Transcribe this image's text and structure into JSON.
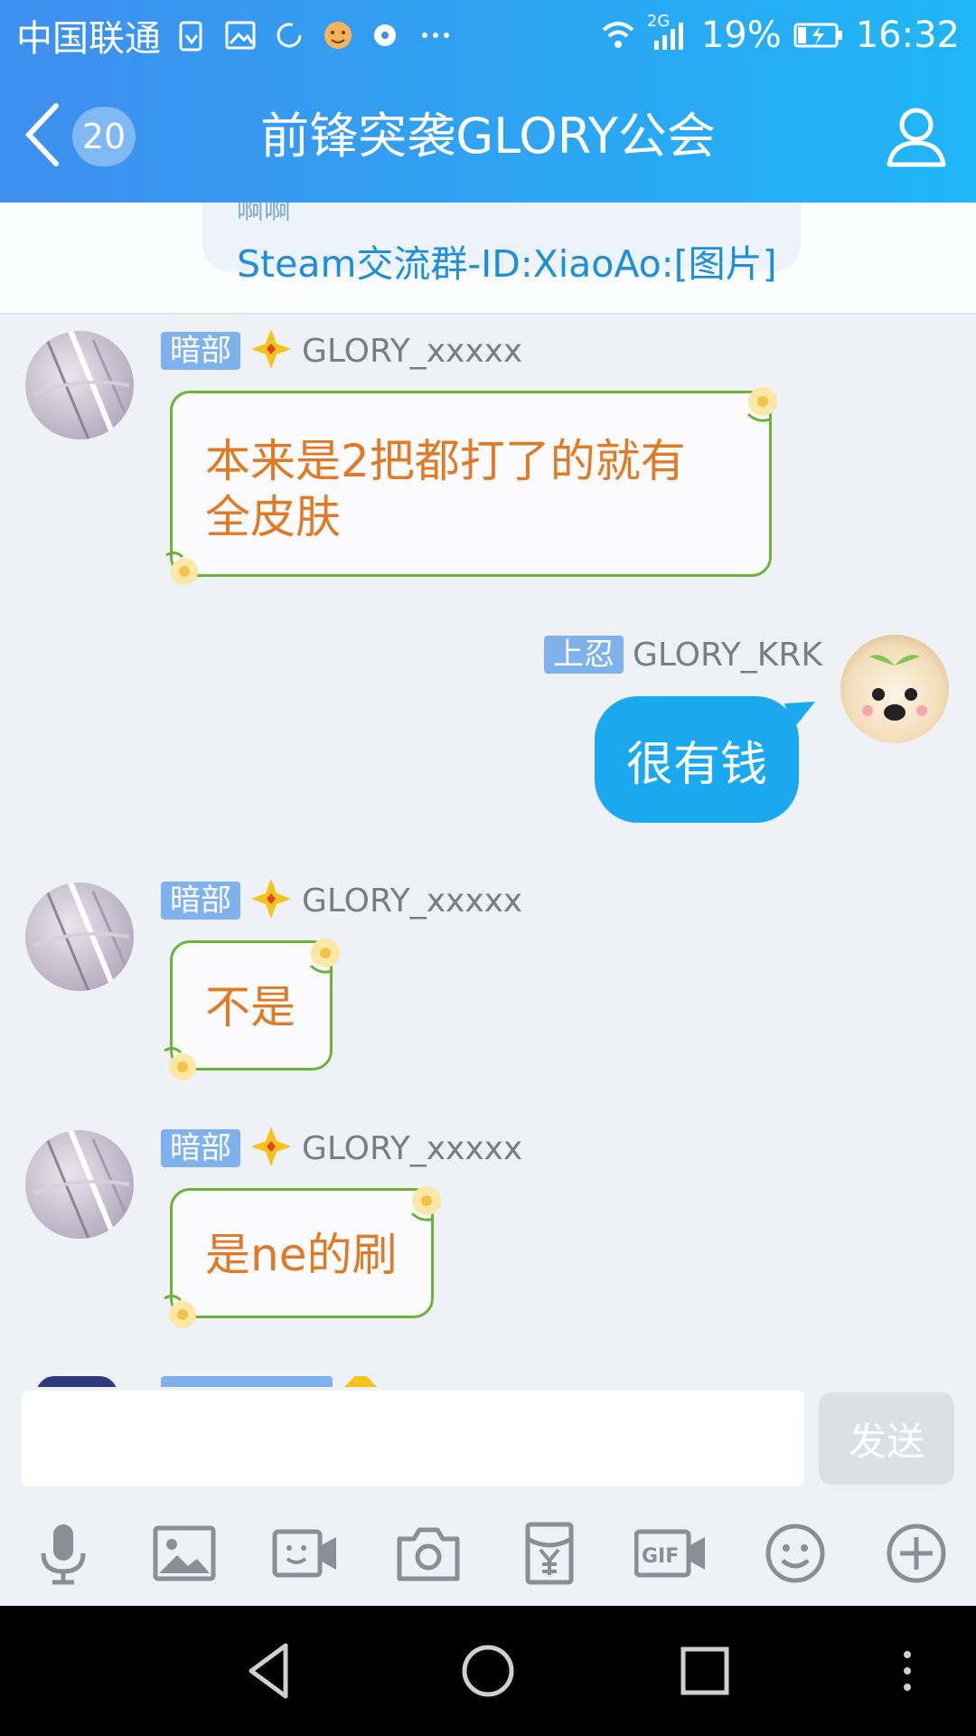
{
  "status_bar": {
    "carrier": "中国联通",
    "network": "2G",
    "battery": "19%",
    "time": "16:32"
  },
  "header": {
    "back_count": "20",
    "title": "前锋突袭GLORY公会"
  },
  "pinned": {
    "cut_text": "啊啊",
    "text": "Steam交流群-ID:XiaoAo:[图片]"
  },
  "messages": [
    {
      "rank": "暗部",
      "nick": "GLORY_xxxxx",
      "text_line1": "本来是2把都打了的就有",
      "text_line2": "全皮肤"
    },
    {
      "rank": "上忍",
      "nick": "GLORY_KRK",
      "text": "很有钱"
    },
    {
      "rank": "暗部",
      "nick": "GLORY_xxxxx",
      "text": "不是"
    },
    {
      "rank": "暗部",
      "nick": "GLORY_xxxxx",
      "text": "是ne的刷"
    }
  ],
  "input": {
    "placeholder": "",
    "send_label": "发送"
  },
  "toolbar_icons": [
    "microphone-icon",
    "image-icon",
    "video-chat-icon",
    "camera-icon",
    "red-packet-icon",
    "gif-icon",
    "emoji-icon",
    "plus-icon"
  ]
}
